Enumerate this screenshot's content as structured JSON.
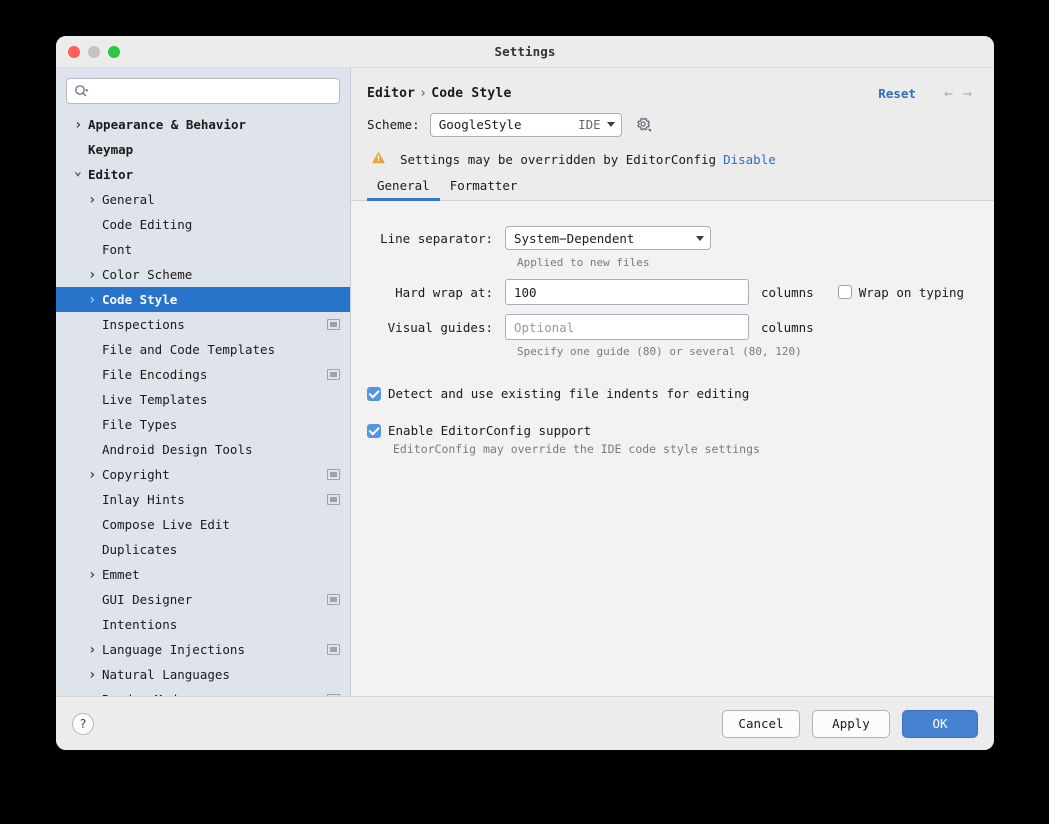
{
  "window": {
    "title": "Settings",
    "traffic_lights": [
      "close",
      "minimize",
      "zoom"
    ]
  },
  "sidebar": {
    "search": {
      "value": "",
      "placeholder": ""
    },
    "items": [
      {
        "label": "Appearance & Behavior",
        "depth": 1,
        "arrow": "collapsed",
        "bold": true,
        "badge": false,
        "selected": false
      },
      {
        "label": "Keymap",
        "depth": 1,
        "arrow": "none",
        "bold": true,
        "badge": false,
        "selected": false
      },
      {
        "label": "Editor",
        "depth": 1,
        "arrow": "expanded",
        "bold": true,
        "badge": false,
        "selected": false
      },
      {
        "label": "General",
        "depth": 2,
        "arrow": "collapsed",
        "bold": false,
        "badge": false,
        "selected": false
      },
      {
        "label": "Code Editing",
        "depth": 2,
        "arrow": "none",
        "bold": false,
        "badge": false,
        "selected": false
      },
      {
        "label": "Font",
        "depth": 2,
        "arrow": "none",
        "bold": false,
        "badge": false,
        "selected": false
      },
      {
        "label": "Color Scheme",
        "depth": 2,
        "arrow": "collapsed",
        "bold": false,
        "badge": false,
        "selected": false
      },
      {
        "label": "Code Style",
        "depth": 2,
        "arrow": "collapsed",
        "bold": false,
        "badge": false,
        "selected": true
      },
      {
        "label": "Inspections",
        "depth": 2,
        "arrow": "none",
        "bold": false,
        "badge": true,
        "selected": false
      },
      {
        "label": "File and Code Templates",
        "depth": 2,
        "arrow": "none",
        "bold": false,
        "badge": false,
        "selected": false
      },
      {
        "label": "File Encodings",
        "depth": 2,
        "arrow": "none",
        "bold": false,
        "badge": true,
        "selected": false
      },
      {
        "label": "Live Templates",
        "depth": 2,
        "arrow": "none",
        "bold": false,
        "badge": false,
        "selected": false
      },
      {
        "label": "File Types",
        "depth": 2,
        "arrow": "none",
        "bold": false,
        "badge": false,
        "selected": false
      },
      {
        "label": "Android Design Tools",
        "depth": 2,
        "arrow": "none",
        "bold": false,
        "badge": false,
        "selected": false
      },
      {
        "label": "Copyright",
        "depth": 2,
        "arrow": "collapsed",
        "bold": false,
        "badge": true,
        "selected": false
      },
      {
        "label": "Inlay Hints",
        "depth": 2,
        "arrow": "none",
        "bold": false,
        "badge": true,
        "selected": false
      },
      {
        "label": "Compose Live Edit",
        "depth": 2,
        "arrow": "none",
        "bold": false,
        "badge": false,
        "selected": false
      },
      {
        "label": "Duplicates",
        "depth": 2,
        "arrow": "none",
        "bold": false,
        "badge": false,
        "selected": false
      },
      {
        "label": "Emmet",
        "depth": 2,
        "arrow": "collapsed",
        "bold": false,
        "badge": false,
        "selected": false
      },
      {
        "label": "GUI Designer",
        "depth": 2,
        "arrow": "none",
        "bold": false,
        "badge": true,
        "selected": false
      },
      {
        "label": "Intentions",
        "depth": 2,
        "arrow": "none",
        "bold": false,
        "badge": false,
        "selected": false
      },
      {
        "label": "Language Injections",
        "depth": 2,
        "arrow": "collapsed",
        "bold": false,
        "badge": true,
        "selected": false
      },
      {
        "label": "Natural Languages",
        "depth": 2,
        "arrow": "collapsed",
        "bold": false,
        "badge": false,
        "selected": false
      },
      {
        "label": "Reader Mode",
        "depth": 2,
        "arrow": "none",
        "bold": false,
        "badge": true,
        "selected": false
      }
    ]
  },
  "main": {
    "breadcrumb": {
      "root": "Editor",
      "separator": "›",
      "leaf": "Code Style"
    },
    "reset_label": "Reset",
    "nav_back": "←",
    "nav_forward": "→",
    "scheme": {
      "label": "Scheme:",
      "value": "GoogleStyle",
      "suffix": "IDE",
      "gear_icon": "gear-icon"
    },
    "warning": {
      "icon": "warning-triangle-icon",
      "text": "Settings may be overridden by EditorConfig",
      "action_label": "Disable"
    },
    "tabs": [
      {
        "label": "General",
        "active": true
      },
      {
        "label": "Formatter",
        "active": false
      }
    ],
    "form": {
      "line_separator": {
        "label": "Line separator:",
        "value": "System−Dependent",
        "hint": "Applied to new files"
      },
      "hard_wrap": {
        "label": "Hard wrap at:",
        "value": "100",
        "placeholder": "",
        "unit": "columns"
      },
      "wrap_on_typing": {
        "label": "Wrap on typing",
        "checked": false
      },
      "visual_guides": {
        "label": "Visual guides:",
        "value": "",
        "placeholder": "Optional",
        "unit": "columns",
        "hint": "Specify one guide (80) or several (80, 120)"
      },
      "detect_indents": {
        "label": "Detect and use existing file indents for editing",
        "checked": true
      },
      "enable_editorconfig": {
        "label": "Enable EditorConfig support",
        "checked": true,
        "hint": "EditorConfig may override the IDE code style settings"
      }
    }
  },
  "footer": {
    "help_label": "?",
    "cancel_label": "Cancel",
    "apply_label": "Apply",
    "ok_label": "OK"
  },
  "colors": {
    "accent_blue": "#2675CB",
    "link_blue": "#2D6FBE",
    "tab_underline": "#3574C8",
    "primary_button": "#4682D1",
    "warning_orange": "#E8A33D",
    "sidebar_bg": "#DFE3EB",
    "panel_bg": "#F2F2F2",
    "chrome_bg": "#ECECEC"
  }
}
